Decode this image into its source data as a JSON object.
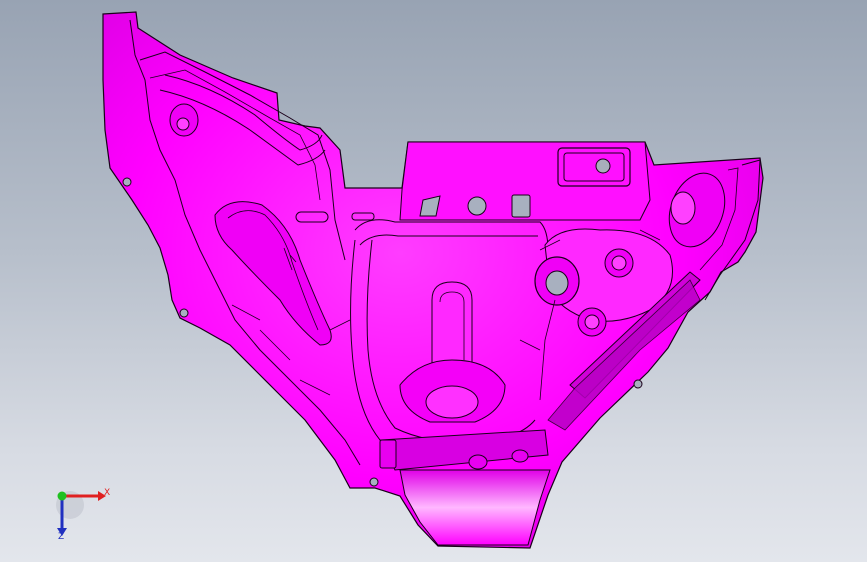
{
  "viewport": {
    "background_top": "#98a3b3",
    "background_bottom": "#e3e6ec"
  },
  "part": {
    "face_color": "#ff00ff",
    "shade_color": "#c000c8",
    "edge_color": "#1a001a"
  },
  "triad": {
    "x_label": "X",
    "z_label": "Z",
    "x_color": "#e02020",
    "y_color": "#20c020",
    "z_color": "#2030c0"
  }
}
